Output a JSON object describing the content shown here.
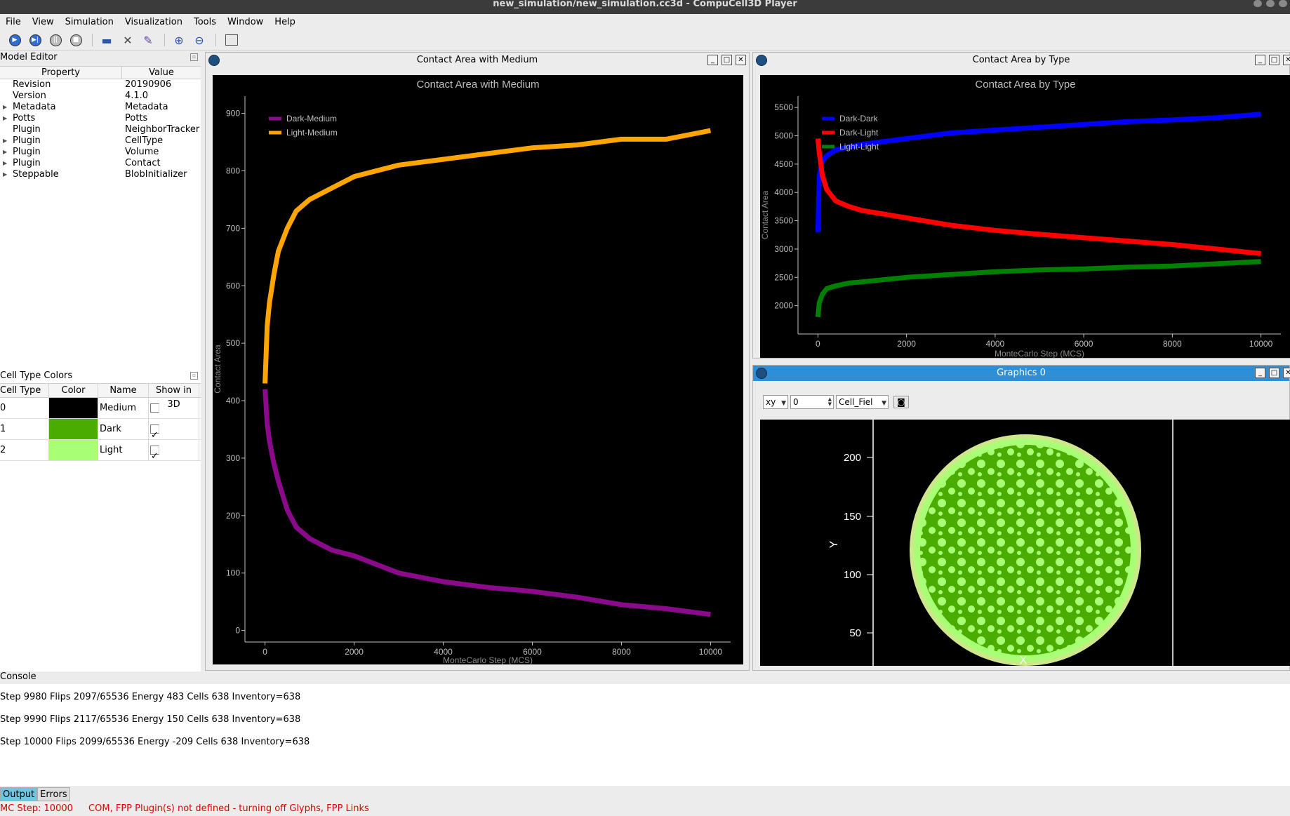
{
  "window": {
    "title": "new_simulation/new_simulation.cc3d - CompuCell3D Player"
  },
  "menu": [
    "File",
    "View",
    "Simulation",
    "Visualization",
    "Tools",
    "Window",
    "Help"
  ],
  "toolbar": {
    "icons": [
      "run-icon",
      "step-icon",
      "pause-icon",
      "stop-icon",
      "open-icon",
      "tools-icon",
      "edit-icon",
      "zoom-in-icon",
      "zoom-out-icon",
      "cascade-icon"
    ]
  },
  "model_editor": {
    "title": "Model Editor",
    "columns": [
      "Property",
      "Value"
    ],
    "rows": [
      {
        "property": "Revision",
        "value": "20190906",
        "expandable": false
      },
      {
        "property": "Version",
        "value": "4.1.0",
        "expandable": false
      },
      {
        "property": "Metadata",
        "value": "Metadata",
        "expandable": true
      },
      {
        "property": "Potts",
        "value": "Potts",
        "expandable": true
      },
      {
        "property": "Plugin",
        "value": "NeighborTracker",
        "expandable": false
      },
      {
        "property": "Plugin",
        "value": "CellType",
        "expandable": true
      },
      {
        "property": "Plugin",
        "value": "Volume",
        "expandable": true
      },
      {
        "property": "Plugin",
        "value": "Contact",
        "expandable": true
      },
      {
        "property": "Steppable",
        "value": "BlobInitializer",
        "expandable": true
      }
    ]
  },
  "cell_type_colors": {
    "title": "Cell Type Colors",
    "columns": [
      "Cell Type Id",
      "Color",
      "Name",
      "Show in 3D"
    ],
    "rows": [
      {
        "id": "0",
        "color": "#000000",
        "name": "Medium",
        "show": false
      },
      {
        "id": "1",
        "color": "#4aab00",
        "name": "Dark",
        "show": true
      },
      {
        "id": "2",
        "color": "#a8ff75",
        "name": "Light",
        "show": true
      }
    ]
  },
  "windows": {
    "medium_window_title": "Contact Area with Medium",
    "type_window_title": "Contact Area by Type",
    "graphics_window_title": "Graphics 0"
  },
  "graphics_controls": {
    "plane": "xy",
    "slice": "0",
    "field": "Cell_Fiel",
    "y_ticks": [
      "200",
      "150",
      "100",
      "50"
    ],
    "x_label": "X",
    "y_label": "Y"
  },
  "chart_data": [
    {
      "type": "line",
      "title": "Contact Area with Medium",
      "xlabel": "MonteCarlo Step (MCS)",
      "ylabel": "Contact Area",
      "xlim": [
        -450,
        10450
      ],
      "ylim": [
        -20,
        930
      ],
      "x_ticks": [
        0,
        2000,
        4000,
        6000,
        8000,
        10000
      ],
      "y_ticks": [
        0,
        100,
        200,
        300,
        400,
        500,
        600,
        700,
        800,
        900
      ],
      "legend": "top-left",
      "series": [
        {
          "name": "Dark-Medium",
          "color": "#8b0a8b",
          "x": [
            0,
            50,
            100,
            200,
            300,
            500,
            700,
            1000,
            1500,
            2000,
            3000,
            4000,
            5000,
            6000,
            7000,
            8000,
            9000,
            10000
          ],
          "y": [
            420,
            360,
            330,
            290,
            260,
            210,
            180,
            160,
            140,
            130,
            100,
            85,
            75,
            68,
            58,
            45,
            38,
            28
          ]
        },
        {
          "name": "Light-Medium",
          "color": "#ffa500",
          "x": [
            0,
            50,
            100,
            200,
            300,
            500,
            700,
            1000,
            1500,
            2000,
            3000,
            4000,
            5000,
            6000,
            7000,
            8000,
            9000,
            10000
          ],
          "y": [
            430,
            530,
            570,
            620,
            660,
            700,
            730,
            750,
            770,
            790,
            810,
            820,
            830,
            840,
            845,
            855,
            855,
            870
          ]
        }
      ]
    },
    {
      "type": "line",
      "title": "Contact Area by Type",
      "xlabel": "MonteCarlo Step (MCS)",
      "ylabel": "Contact Area",
      "xlim": [
        -450,
        10450
      ],
      "ylim": [
        1500,
        5700
      ],
      "x_ticks": [
        0,
        2000,
        4000,
        6000,
        8000,
        10000
      ],
      "y_ticks": [
        2000,
        2500,
        3000,
        3500,
        4000,
        4500,
        5000,
        5500
      ],
      "legend": "top-left",
      "series": [
        {
          "name": "Dark-Dark",
          "color": "#0000ff",
          "x": [
            0,
            30,
            100,
            200,
            400,
            700,
            1000,
            2000,
            3000,
            4000,
            5000,
            6000,
            7000,
            8000,
            9000,
            10000
          ],
          "y": [
            3300,
            4300,
            4550,
            4650,
            4750,
            4800,
            4850,
            4950,
            5050,
            5100,
            5150,
            5200,
            5250,
            5280,
            5320,
            5380
          ]
        },
        {
          "name": "Dark-Light",
          "color": "#ff0000",
          "x": [
            0,
            30,
            100,
            200,
            400,
            700,
            1000,
            2000,
            3000,
            4000,
            5000,
            6000,
            7000,
            8000,
            9000,
            10000
          ],
          "y": [
            4950,
            4700,
            4300,
            4050,
            3850,
            3750,
            3680,
            3550,
            3420,
            3330,
            3260,
            3200,
            3140,
            3080,
            3000,
            2920
          ]
        },
        {
          "name": "Light-Light",
          "color": "#008000",
          "x": [
            0,
            30,
            100,
            200,
            400,
            700,
            1000,
            2000,
            3000,
            4000,
            5000,
            6000,
            7000,
            8000,
            9000,
            10000
          ],
          "y": [
            1800,
            2050,
            2200,
            2300,
            2350,
            2400,
            2420,
            2500,
            2550,
            2600,
            2630,
            2650,
            2680,
            2700,
            2740,
            2780
          ]
        }
      ]
    }
  ],
  "console": {
    "title": "Console",
    "lines": [
      "Step 9980 Flips 2097/65536 Energy 483 Cells 638 Inventory=638",
      "Step 9990 Flips 2117/65536 Energy 150 Cells 638 Inventory=638",
      "Step 10000 Flips 2099/65536 Energy -209 Cells 638 Inventory=638"
    ],
    "tabs": [
      "Output",
      "Errors"
    ]
  },
  "status": {
    "mcs": "MC Step: 10000",
    "message": "COM, FPP Plugin(s) not defined - turning off Glyphs, FPP Links"
  },
  "colors": {
    "dark_cell": "#4aab00",
    "light_cell": "#a8ff75",
    "active_title": "#2f8fd6",
    "status_red": "#e00000"
  }
}
